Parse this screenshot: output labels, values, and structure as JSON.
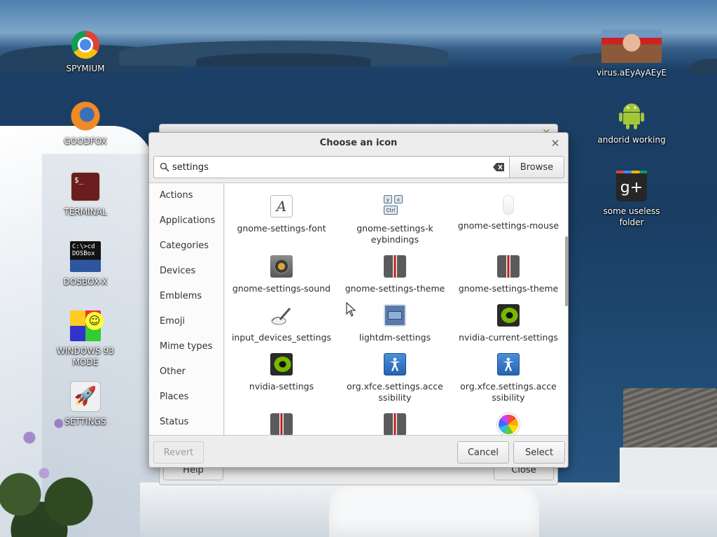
{
  "desktop": {
    "icons": [
      {
        "label": "SPYMIUM",
        "icon": "chrome-icon"
      },
      {
        "label": "GOODFOX",
        "icon": "firefox-icon"
      },
      {
        "label": "TERMINAL",
        "icon": "terminal-icon",
        "glyph": "$_"
      },
      {
        "label": "DOSBOX-X",
        "icon": "dosbox-icon",
        "glyph": "C:\\>cd\nDOSBox"
      },
      {
        "label": "WINDOWS 93 MODE",
        "icon": "windows93-icon"
      },
      {
        "label": "SETTINGS",
        "icon": "rocket-icon"
      },
      {
        "label": "virus.aEyAyAEyE",
        "icon": "virus-image-icon"
      },
      {
        "label": "andorid working",
        "icon": "android-icon"
      },
      {
        "label": "some useless folder",
        "icon": "google-plus-icon",
        "glyph": "g+"
      }
    ]
  },
  "background_window": {
    "help_label": "Help",
    "close_label": "Close"
  },
  "dialog": {
    "title": "Choose an icon",
    "search": {
      "value": "settings",
      "browse_label": "Browse"
    },
    "categories": [
      "Actions",
      "Applications",
      "Categories",
      "Devices",
      "Emblems",
      "Emoji",
      "Mime types",
      "Other",
      "Places",
      "Status"
    ],
    "icons": [
      {
        "label": "gnome-settings-font",
        "icon": "font-icon",
        "glyph": "A"
      },
      {
        "label": "gnome-settings-keybindings",
        "icon": "keyboard-icon"
      },
      {
        "label": "gnome-settings-mouse",
        "icon": "mouse-icon"
      },
      {
        "label": "gnome-settings-sound",
        "icon": "speaker-icon"
      },
      {
        "label": "gnome-settings-theme",
        "icon": "suit-tie-icon"
      },
      {
        "label": "gnome-settings-theme",
        "icon": "suit-tie-icon"
      },
      {
        "label": "input_devices_settings",
        "icon": "pen-tablet-icon"
      },
      {
        "label": "lightdm-settings",
        "icon": "monitor-icon"
      },
      {
        "label": "nvidia-current-settings",
        "icon": "nvidia-icon"
      },
      {
        "label": "nvidia-settings",
        "icon": "nvidia-icon"
      },
      {
        "label": "org.xfce.settings.accessibility",
        "icon": "accessibility-icon"
      },
      {
        "label": "org.xfce.settings.accessibility",
        "icon": "accessibility-icon"
      },
      {
        "label": "",
        "icon": "suit-tie-icon"
      },
      {
        "label": "",
        "icon": "suit-tie-icon"
      },
      {
        "label": "",
        "icon": "photos-icon"
      }
    ],
    "buttons": {
      "revert": "Revert",
      "cancel": "Cancel",
      "select": "Select"
    }
  }
}
